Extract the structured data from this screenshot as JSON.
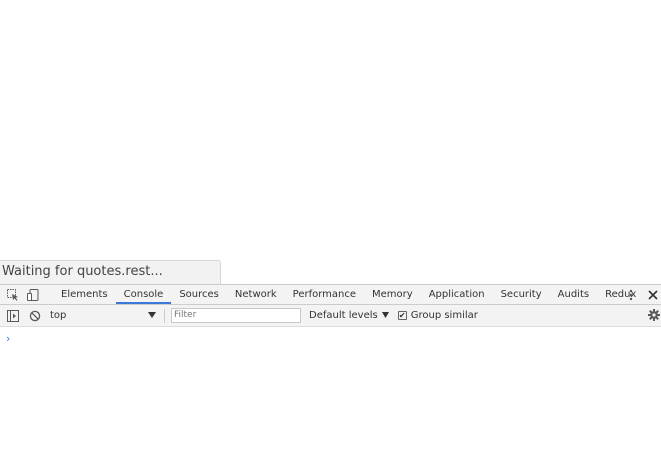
{
  "status_bubble": {
    "text": "Waiting for quotes.rest..."
  },
  "devtools": {
    "tabs": [
      {
        "label": "Elements",
        "active": false
      },
      {
        "label": "Console",
        "active": true
      },
      {
        "label": "Sources",
        "active": false
      },
      {
        "label": "Network",
        "active": false
      },
      {
        "label": "Performance",
        "active": false
      },
      {
        "label": "Memory",
        "active": false
      },
      {
        "label": "Application",
        "active": false
      },
      {
        "label": "Security",
        "active": false
      },
      {
        "label": "Audits",
        "active": false
      },
      {
        "label": "Redux",
        "active": false
      }
    ],
    "toolbar": {
      "context": "top",
      "filter_placeholder": "Filter",
      "levels_label": "Default levels",
      "group_similar_label": "Group similar",
      "group_similar_checked": true
    },
    "console": {
      "prompt_symbol": "›"
    },
    "colors": {
      "active_tab_underline": "#3879d9",
      "prompt": "#367cf1"
    },
    "icons": [
      "inspect-element-icon",
      "device-toolbar-icon",
      "more-options-icon",
      "close-icon",
      "sidebar-toggle-icon",
      "clear-console-icon",
      "dropdown-arrow-icon",
      "gear-icon"
    ]
  }
}
